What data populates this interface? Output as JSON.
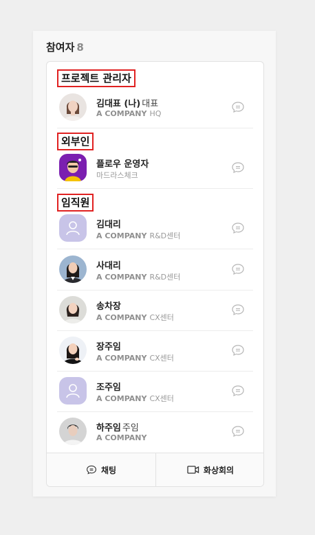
{
  "panel": {
    "title": "참여자",
    "count": "8"
  },
  "sections": {
    "managers": "프로젝트 관리자",
    "external": "외부인",
    "staff": "임직원"
  },
  "people": [
    {
      "name": "김대표 (나)",
      "role": "대표",
      "company": "A COMPANY",
      "dept": "HQ",
      "avatar": "photo-woman"
    },
    {
      "name": "플로우 운영자",
      "role": "",
      "company": "마드라스체크",
      "dept": "",
      "avatar": "illustration"
    },
    {
      "name": "김대리",
      "role": "",
      "company": "A COMPANY",
      "dept": "R&D센터",
      "avatar": "placeholder-person-icon"
    },
    {
      "name": "사대리",
      "role": "",
      "company": "A COMPANY",
      "dept": "R&D센터",
      "avatar": "photo-woman"
    },
    {
      "name": "송차장",
      "role": "",
      "company": "A COMPANY",
      "dept": "CX센터",
      "avatar": "photo-woman"
    },
    {
      "name": "장주임",
      "role": "",
      "company": "A COMPANY",
      "dept": "CX센터",
      "avatar": "photo-woman"
    },
    {
      "name": "조주임",
      "role": "",
      "company": "A COMPANY",
      "dept": "CX센터",
      "avatar": "placeholder-person-icon"
    },
    {
      "name": "하주임",
      "role": "주임",
      "company": "A COMPANY",
      "dept": "",
      "avatar": "photo-man"
    }
  ],
  "footer": {
    "chat_label": "채팅",
    "video_label": "화상회의"
  },
  "colors": {
    "highlight_border": "#e02020",
    "placeholder_avatar": "#c8c4e8"
  }
}
